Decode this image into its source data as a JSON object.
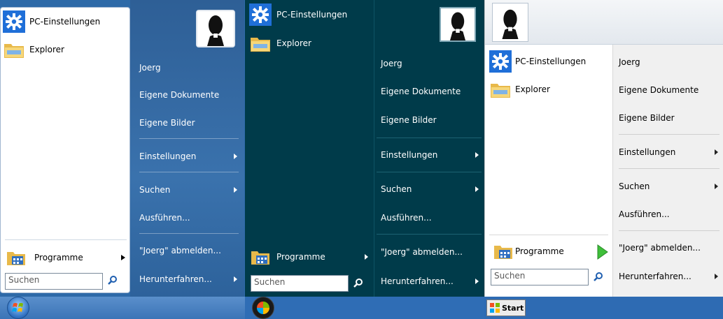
{
  "menus": [
    {
      "pinned": [
        {
          "label": "PC-Einstellungen",
          "icon": "gear-icon"
        },
        {
          "label": "Explorer",
          "icon": "folder-icon"
        }
      ],
      "programs_label": "Programme",
      "search_placeholder": "Suchen",
      "right": [
        {
          "label": "Joerg"
        },
        {
          "label": "Eigene Dokumente"
        },
        {
          "label": "Eigene Bilder"
        },
        {
          "label": "Einstellungen"
        },
        {
          "label": "Suchen"
        },
        {
          "label": "Ausführen..."
        },
        {
          "label": "\"Joerg\" abmelden..."
        },
        {
          "label": "Herunterfahren..."
        }
      ]
    },
    {
      "pinned": [
        {
          "label": "PC-Einstellungen",
          "icon": "gear-icon"
        },
        {
          "label": "Explorer",
          "icon": "folder-icon"
        }
      ],
      "programs_label": "Programme",
      "search_placeholder": "Suchen",
      "right": [
        {
          "label": "Joerg"
        },
        {
          "label": "Eigene Dokumente"
        },
        {
          "label": "Eigene Bilder"
        },
        {
          "label": "Einstellungen"
        },
        {
          "label": "Suchen"
        },
        {
          "label": "Ausführen..."
        },
        {
          "label": "\"Joerg\" abmelden..."
        },
        {
          "label": "Herunterfahren..."
        }
      ]
    },
    {
      "pinned": [
        {
          "label": "PC-Einstellungen",
          "icon": "gear-icon"
        },
        {
          "label": "Explorer",
          "icon": "folder-icon"
        }
      ],
      "programs_label": "Programme",
      "search_placeholder": "Suchen",
      "right": [
        {
          "label": "Joerg"
        },
        {
          "label": "Eigene Dokumente"
        },
        {
          "label": "Eigene Bilder"
        },
        {
          "label": "Einstellungen"
        },
        {
          "label": "Suchen"
        },
        {
          "label": "Ausführen..."
        },
        {
          "label": "\"Joerg\" abmelden..."
        },
        {
          "label": "Herunterfahren..."
        }
      ]
    }
  ],
  "taskbar": {
    "start_label": "Start"
  },
  "colors": {
    "taskbar_blue": "#3b77c0",
    "win8_teal": "#003b4a",
    "accent_gear": "#1f6fd8"
  }
}
